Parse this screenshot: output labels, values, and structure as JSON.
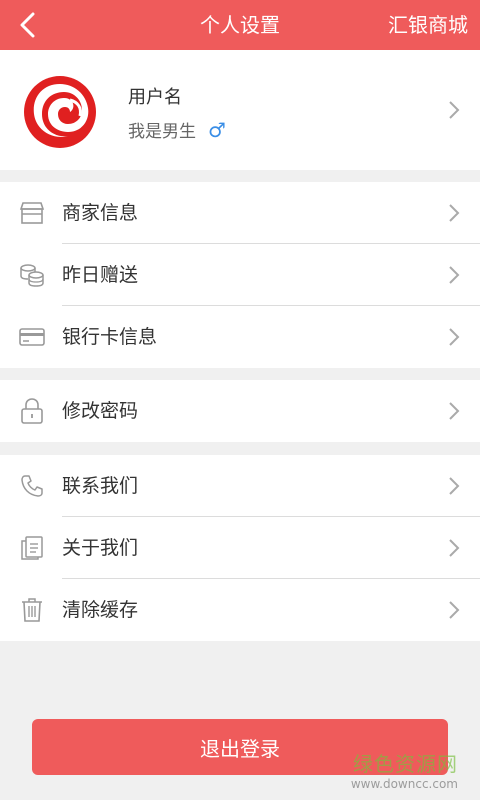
{
  "header": {
    "title": "个人设置",
    "right_link": "汇银商城",
    "back_icon": "chevron-left-icon",
    "bg_color": "#ef5b5b"
  },
  "profile": {
    "username": "用户名",
    "gender_text": "我是男生",
    "gender_symbol": "♂",
    "gender_color": "#3a8ee6"
  },
  "groups": [
    {
      "items": [
        {
          "label": "商家信息",
          "icon": "store-icon"
        },
        {
          "label": "昨日赠送",
          "icon": "coins-icon"
        },
        {
          "label": "银行卡信息",
          "icon": "bank-card-icon"
        }
      ]
    },
    {
      "items": [
        {
          "label": "修改密码",
          "icon": "lock-icon"
        }
      ]
    },
    {
      "items": [
        {
          "label": "联系我们",
          "icon": "phone-icon"
        },
        {
          "label": "关于我们",
          "icon": "document-icon"
        },
        {
          "label": "清除缓存",
          "icon": "trash-icon"
        }
      ]
    }
  ],
  "logout_label": "退出登录",
  "watermark": {
    "text": "绿色资源网",
    "url": "www.downcc.com"
  }
}
